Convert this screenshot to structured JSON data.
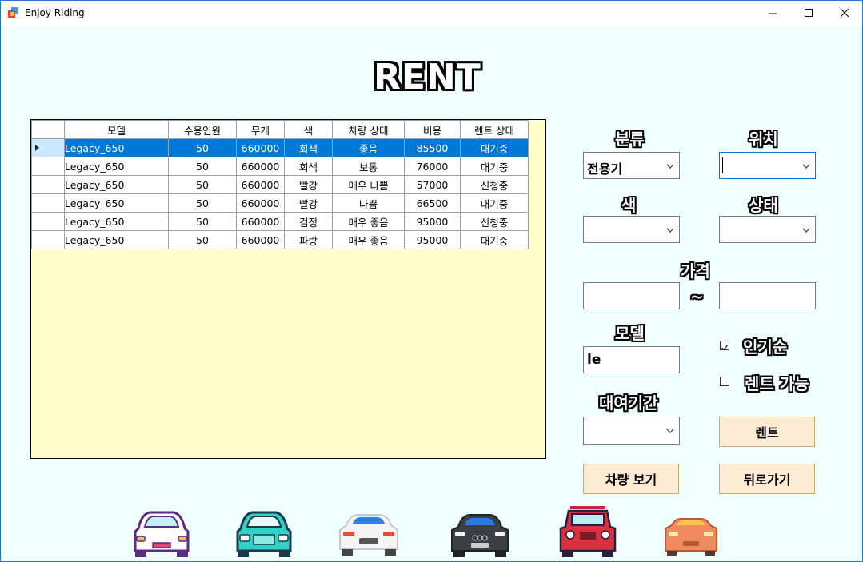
{
  "window": {
    "title": "Enjoy Riding"
  },
  "heading": "RENT",
  "grid": {
    "columns": [
      "모델",
      "수용인원",
      "무게",
      "색",
      "차량 상태",
      "비용",
      "렌트 상태"
    ],
    "rows": [
      [
        "Legacy_650",
        "50",
        "660000",
        "회색",
        "좋음",
        "85500",
        "대기중"
      ],
      [
        "Legacy_650",
        "50",
        "660000",
        "회색",
        "보통",
        "76000",
        "대기중"
      ],
      [
        "Legacy_650",
        "50",
        "660000",
        "빨강",
        "매우 나쁨",
        "57000",
        "신청중"
      ],
      [
        "Legacy_650",
        "50",
        "660000",
        "빨강",
        "나쁨",
        "66500",
        "대기중"
      ],
      [
        "Legacy_650",
        "50",
        "660000",
        "검정",
        "매우 좋음",
        "95000",
        "신청중"
      ],
      [
        "Legacy_650",
        "50",
        "660000",
        "파랑",
        "매우 좋음",
        "95000",
        "대기중"
      ]
    ],
    "selected_row": 0
  },
  "filters": {
    "category_label": "분류",
    "category_value": "전용기",
    "location_label": "위치",
    "location_value": "",
    "color_label": "색",
    "color_value": "",
    "status_label": "상태",
    "status_value": "",
    "price_label": "가격",
    "price_sep": "~",
    "price_min": "",
    "price_max": "",
    "model_label": "모델",
    "model_value": "le",
    "popular_label": "인기순",
    "popular_checked": true,
    "rentable_label": "렌트 가능",
    "rentable_checked": false,
    "period_label": "대여기간",
    "period_value": ""
  },
  "buttons": {
    "rent": "렌트",
    "view": "차량 보기",
    "back": "뒤로가기"
  },
  "colors": {
    "accent": "#0078d7",
    "grid_bg": "#fffdc8",
    "button_bg": "#fdebd3",
    "window_bg": "#f0ffff"
  },
  "icons": [
    "purple-car-icon",
    "teal-car-icon",
    "white-car-icon",
    "black-car-icon",
    "red-jeep-icon",
    "orange-car-icon"
  ]
}
